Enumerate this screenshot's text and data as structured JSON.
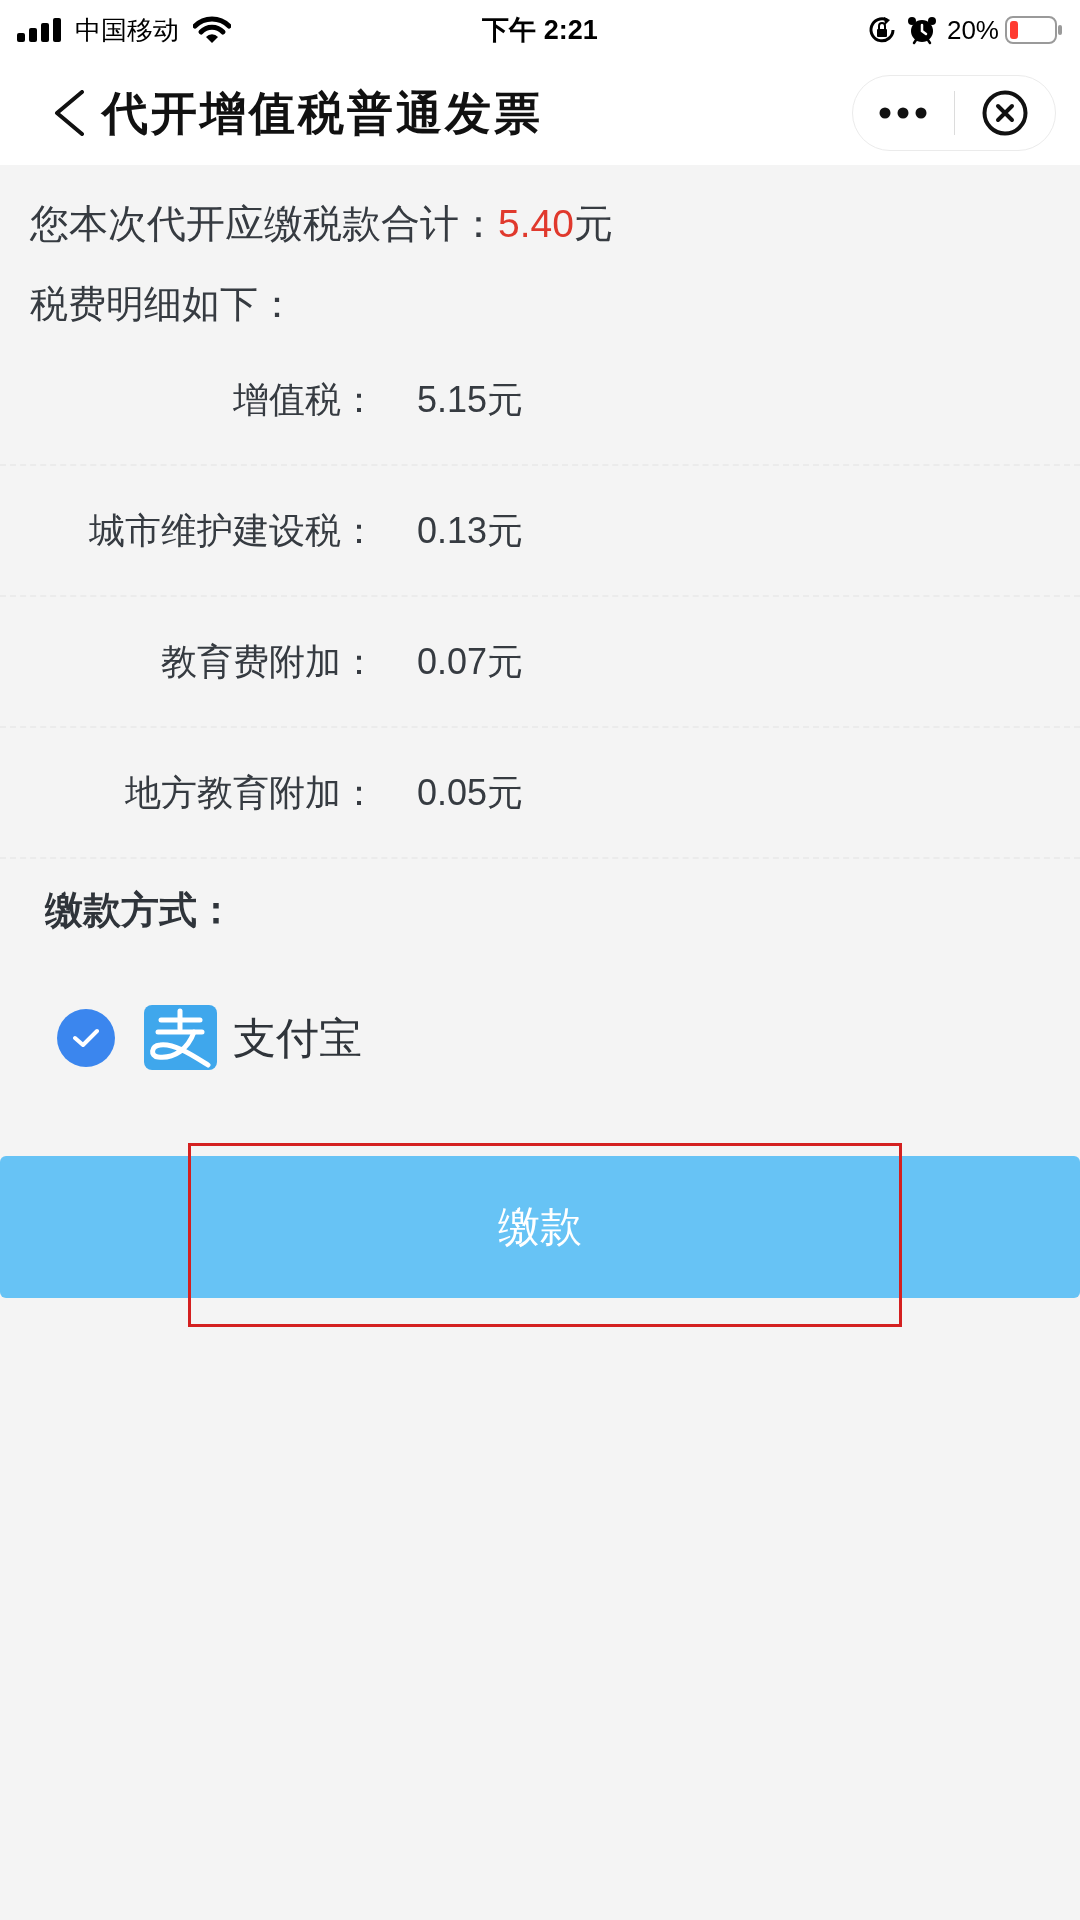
{
  "status_bar": {
    "carrier": "中国移动",
    "time": "下午 2:21",
    "battery": "20%"
  },
  "nav_bar": {
    "title": "代开增值税普通发票"
  },
  "summary": {
    "label": "您本次代开应缴税款合计：",
    "amount": "5.40",
    "unit": "元"
  },
  "details_heading": "税费明细如下：",
  "tax_items": [
    {
      "label": "增值税：",
      "value": "5.15元"
    },
    {
      "label": "城市维护建设税：",
      "value": "0.13元"
    },
    {
      "label": "教育费附加：",
      "value": "0.07元"
    },
    {
      "label": "地方教育附加：",
      "value": "0.05元"
    }
  ],
  "payment": {
    "heading": "缴款方式：",
    "methods": [
      {
        "name": "支付宝",
        "selected": true
      }
    ]
  },
  "pay_button": {
    "label": "缴款",
    "highlighted": true
  }
}
